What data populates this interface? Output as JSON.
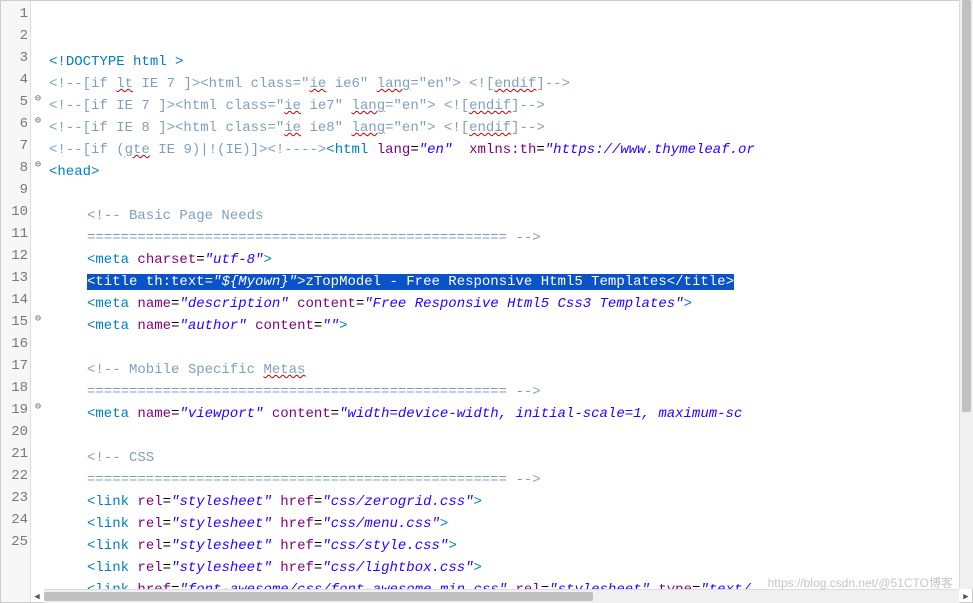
{
  "gutter": {
    "lineNumbers": [
      "1",
      "2",
      "3",
      "4",
      "5",
      "6",
      "7",
      "8",
      "9",
      "10",
      "11",
      "12",
      "13",
      "14",
      "15",
      "16",
      "17",
      "18",
      "19",
      "20",
      "21",
      "22",
      "23",
      "24",
      "25"
    ],
    "foldMarkers": [
      "",
      "",
      "",
      "",
      "⊖",
      "⊖",
      "",
      "⊖",
      "",
      "",
      "",
      "",
      "",
      "",
      "⊖",
      "",
      "",
      "",
      "⊖",
      "",
      "",
      "",
      "",
      "",
      ""
    ]
  },
  "code": {
    "selectedLine": 11,
    "lines": [
      {
        "n": 1,
        "tokens": [
          {
            "t": "<!",
            "c": "doctype"
          },
          {
            "t": "DOCTYPE",
            "c": "doctype"
          },
          {
            "t": " ",
            "c": ""
          },
          {
            "t": "html",
            "c": "doctype"
          },
          {
            "t": " >",
            "c": "doctype"
          }
        ]
      },
      {
        "n": 2,
        "tokens": [
          {
            "t": "<!--",
            "c": "cmt"
          },
          {
            "t": "[if ",
            "c": "cmt"
          },
          {
            "t": "lt",
            "c": "cmt squiggle"
          },
          {
            "t": " IE 7 ]>",
            "c": "cmt"
          },
          {
            "t": "<html class=",
            "c": "cmt"
          },
          {
            "t": "\"",
            "c": "cmt"
          },
          {
            "t": "ie",
            "c": "cmt squiggle"
          },
          {
            "t": " ie6\" ",
            "c": "cmt"
          },
          {
            "t": "lang",
            "c": "cmt squiggle"
          },
          {
            "t": "=\"en\"> <![",
            "c": "cmt"
          },
          {
            "t": "endif",
            "c": "cmt squiggle"
          },
          {
            "t": "]",
            "c": "cmt"
          },
          {
            "t": "-->",
            "c": "cmt"
          }
        ]
      },
      {
        "n": 3,
        "tokens": [
          {
            "t": "<!--",
            "c": "cmt"
          },
          {
            "t": "[if IE 7 ]>",
            "c": "cmt"
          },
          {
            "t": "<html class=",
            "c": "cmt"
          },
          {
            "t": "\"",
            "c": "cmt"
          },
          {
            "t": "ie",
            "c": "cmt squiggle"
          },
          {
            "t": " ie7\" ",
            "c": "cmt"
          },
          {
            "t": "lang",
            "c": "cmt squiggle"
          },
          {
            "t": "=\"en\"> <![",
            "c": "cmt"
          },
          {
            "t": "endif",
            "c": "cmt squiggle"
          },
          {
            "t": "]",
            "c": "cmt"
          },
          {
            "t": "-->",
            "c": "cmt"
          }
        ]
      },
      {
        "n": 4,
        "tokens": [
          {
            "t": "<!--",
            "c": "cmt"
          },
          {
            "t": "[if IE 8 ]>",
            "c": "cmt"
          },
          {
            "t": "<html class=",
            "c": "cmt"
          },
          {
            "t": "\"",
            "c": "cmt"
          },
          {
            "t": "ie",
            "c": "cmt squiggle"
          },
          {
            "t": " ie8\" ",
            "c": "cmt"
          },
          {
            "t": "lang",
            "c": "cmt squiggle"
          },
          {
            "t": "=\"en\"> <![",
            "c": "cmt"
          },
          {
            "t": "endif",
            "c": "cmt squiggle"
          },
          {
            "t": "]",
            "c": "cmt"
          },
          {
            "t": "-->",
            "c": "cmt"
          }
        ]
      },
      {
        "n": 5,
        "tokens": [
          {
            "t": "<!--",
            "c": "cmt"
          },
          {
            "t": "[if (",
            "c": "cmt"
          },
          {
            "t": "gte",
            "c": "cmt squiggle"
          },
          {
            "t": " IE 9)|!(IE)]>",
            "c": "cmt"
          },
          {
            "t": "<!--",
            "c": "cmt"
          },
          {
            "t": "-->",
            "c": "cmt"
          },
          {
            "t": "<",
            "c": "tag"
          },
          {
            "t": "html",
            "c": "tag"
          },
          {
            "t": " ",
            "c": ""
          },
          {
            "t": "lang",
            "c": "attr"
          },
          {
            "t": "=",
            "c": ""
          },
          {
            "t": "\"en\"",
            "c": "str"
          },
          {
            "t": "  ",
            "c": ""
          },
          {
            "t": "xmlns:th",
            "c": "attr"
          },
          {
            "t": "=",
            "c": ""
          },
          {
            "t": "\"https://www.thymeleaf.or",
            "c": "str"
          }
        ]
      },
      {
        "n": 6,
        "tokens": [
          {
            "t": "<",
            "c": "tag"
          },
          {
            "t": "head",
            "c": "tag"
          },
          {
            "t": ">",
            "c": "tag"
          }
        ]
      },
      {
        "n": 7,
        "tokens": []
      },
      {
        "n": 8,
        "indent": "indent1",
        "tokens": [
          {
            "t": "<!-- Basic Page Needs",
            "c": "cmt"
          }
        ]
      },
      {
        "n": 9,
        "indent": "indent1",
        "tokens": [
          {
            "t": "================================================== -->",
            "c": "cmt"
          }
        ]
      },
      {
        "n": 10,
        "indent": "indent1",
        "tokens": [
          {
            "t": "<",
            "c": "tag"
          },
          {
            "t": "meta",
            "c": "tag"
          },
          {
            "t": " ",
            "c": ""
          },
          {
            "t": "charset",
            "c": "attr"
          },
          {
            "t": "=",
            "c": ""
          },
          {
            "t": "\"utf-8\"",
            "c": "str"
          },
          {
            "t": ">",
            "c": "tag"
          }
        ]
      },
      {
        "n": 11,
        "indent": "indent1",
        "sel": true,
        "tokens": [
          {
            "t": "<",
            "c": "tag"
          },
          {
            "t": "title",
            "c": "tag"
          },
          {
            "t": " ",
            "c": ""
          },
          {
            "t": "th:text",
            "c": "attr"
          },
          {
            "t": "=",
            "c": ""
          },
          {
            "t": "\"${Myown}\"",
            "c": "str"
          },
          {
            "t": ">",
            "c": "tag"
          },
          {
            "t": "zTopModel - Free Responsive Html5 Templates",
            "c": ""
          },
          {
            "t": "</",
            "c": "tag"
          },
          {
            "t": "title",
            "c": "tag"
          },
          {
            "t": ">",
            "c": "tag"
          }
        ]
      },
      {
        "n": 12,
        "indent": "indent1",
        "tokens": [
          {
            "t": "<",
            "c": "tag"
          },
          {
            "t": "meta",
            "c": "tag"
          },
          {
            "t": " ",
            "c": ""
          },
          {
            "t": "name",
            "c": "attr"
          },
          {
            "t": "=",
            "c": ""
          },
          {
            "t": "\"description\"",
            "c": "str"
          },
          {
            "t": " ",
            "c": ""
          },
          {
            "t": "content",
            "c": "attr"
          },
          {
            "t": "=",
            "c": ""
          },
          {
            "t": "\"Free Responsive Html5 Css3 Templates\"",
            "c": "str"
          },
          {
            "t": ">",
            "c": "tag"
          }
        ]
      },
      {
        "n": 13,
        "indent": "indent1",
        "tokens": [
          {
            "t": "<",
            "c": "tag"
          },
          {
            "t": "meta",
            "c": "tag"
          },
          {
            "t": " ",
            "c": ""
          },
          {
            "t": "name",
            "c": "attr"
          },
          {
            "t": "=",
            "c": ""
          },
          {
            "t": "\"author\"",
            "c": "str"
          },
          {
            "t": " ",
            "c": ""
          },
          {
            "t": "content",
            "c": "attr"
          },
          {
            "t": "=",
            "c": ""
          },
          {
            "t": "\"\"",
            "c": "str"
          },
          {
            "t": ">",
            "c": "tag"
          }
        ]
      },
      {
        "n": 14,
        "tokens": []
      },
      {
        "n": 15,
        "indent": "indent1",
        "tokens": [
          {
            "t": "<!-- Mobile Specific ",
            "c": "cmt"
          },
          {
            "t": "Metas",
            "c": "cmt squiggle"
          }
        ]
      },
      {
        "n": 16,
        "indent": "indent1",
        "tokens": [
          {
            "t": "================================================== -->",
            "c": "cmt"
          }
        ]
      },
      {
        "n": 17,
        "indent": "indent1",
        "tokens": [
          {
            "t": "<",
            "c": "tag"
          },
          {
            "t": "meta",
            "c": "tag"
          },
          {
            "t": " ",
            "c": ""
          },
          {
            "t": "name",
            "c": "attr"
          },
          {
            "t": "=",
            "c": ""
          },
          {
            "t": "\"viewport\"",
            "c": "str"
          },
          {
            "t": " ",
            "c": ""
          },
          {
            "t": "content",
            "c": "attr"
          },
          {
            "t": "=",
            "c": ""
          },
          {
            "t": "\"width=device-width, initial-scale=1, maximum-sc",
            "c": "str"
          }
        ]
      },
      {
        "n": 18,
        "tokens": []
      },
      {
        "n": 19,
        "indent": "indent1",
        "tokens": [
          {
            "t": "<!-- CSS",
            "c": "cmt"
          }
        ]
      },
      {
        "n": 20,
        "indent": "indent1",
        "tokens": [
          {
            "t": "================================================== -->",
            "c": "cmt"
          }
        ]
      },
      {
        "n": 21,
        "indent": "indent1",
        "tokens": [
          {
            "t": "<",
            "c": "tag"
          },
          {
            "t": "link",
            "c": "tag"
          },
          {
            "t": " ",
            "c": ""
          },
          {
            "t": "rel",
            "c": "attr"
          },
          {
            "t": "=",
            "c": ""
          },
          {
            "t": "\"stylesheet\"",
            "c": "str"
          },
          {
            "t": " ",
            "c": ""
          },
          {
            "t": "href",
            "c": "attr"
          },
          {
            "t": "=",
            "c": ""
          },
          {
            "t": "\"css/zerogrid.css\"",
            "c": "str"
          },
          {
            "t": ">",
            "c": "tag"
          }
        ]
      },
      {
        "n": 22,
        "indent": "indent1",
        "tokens": [
          {
            "t": "<",
            "c": "tag"
          },
          {
            "t": "link",
            "c": "tag"
          },
          {
            "t": " ",
            "c": ""
          },
          {
            "t": "rel",
            "c": "attr"
          },
          {
            "t": "=",
            "c": ""
          },
          {
            "t": "\"stylesheet\"",
            "c": "str"
          },
          {
            "t": " ",
            "c": ""
          },
          {
            "t": "href",
            "c": "attr"
          },
          {
            "t": "=",
            "c": ""
          },
          {
            "t": "\"css/menu.css\"",
            "c": "str"
          },
          {
            "t": ">",
            "c": "tag"
          }
        ]
      },
      {
        "n": 23,
        "indent": "indent1",
        "tokens": [
          {
            "t": "<",
            "c": "tag"
          },
          {
            "t": "link",
            "c": "tag"
          },
          {
            "t": " ",
            "c": ""
          },
          {
            "t": "rel",
            "c": "attr"
          },
          {
            "t": "=",
            "c": ""
          },
          {
            "t": "\"stylesheet\"",
            "c": "str"
          },
          {
            "t": " ",
            "c": ""
          },
          {
            "t": "href",
            "c": "attr"
          },
          {
            "t": "=",
            "c": ""
          },
          {
            "t": "\"css/style.css\"",
            "c": "str"
          },
          {
            "t": ">",
            "c": "tag"
          }
        ]
      },
      {
        "n": 24,
        "indent": "indent1",
        "tokens": [
          {
            "t": "<",
            "c": "tag"
          },
          {
            "t": "link",
            "c": "tag"
          },
          {
            "t": " ",
            "c": ""
          },
          {
            "t": "rel",
            "c": "attr"
          },
          {
            "t": "=",
            "c": ""
          },
          {
            "t": "\"stylesheet\"",
            "c": "str"
          },
          {
            "t": " ",
            "c": ""
          },
          {
            "t": "href",
            "c": "attr"
          },
          {
            "t": "=",
            "c": ""
          },
          {
            "t": "\"css/lightbox.css\"",
            "c": "str"
          },
          {
            "t": ">",
            "c": "tag"
          }
        ]
      },
      {
        "n": 25,
        "indent": "indent1",
        "tokens": [
          {
            "t": "<",
            "c": "tag"
          },
          {
            "t": "link",
            "c": "tag"
          },
          {
            "t": " ",
            "c": ""
          },
          {
            "t": "href",
            "c": "attr"
          },
          {
            "t": "=",
            "c": ""
          },
          {
            "t": "\"font-awesome/css/font-awesome.min.css\"",
            "c": "str"
          },
          {
            "t": " ",
            "c": ""
          },
          {
            "t": "rel",
            "c": "attr"
          },
          {
            "t": "=",
            "c": ""
          },
          {
            "t": "\"stylesheet\"",
            "c": "str"
          },
          {
            "t": " ",
            "c": ""
          },
          {
            "t": "type",
            "c": "attr"
          },
          {
            "t": "=",
            "c": ""
          },
          {
            "t": "\"text/",
            "c": "str"
          }
        ]
      }
    ]
  },
  "watermark": "https://blog.csdn.net/@51CTO博客"
}
